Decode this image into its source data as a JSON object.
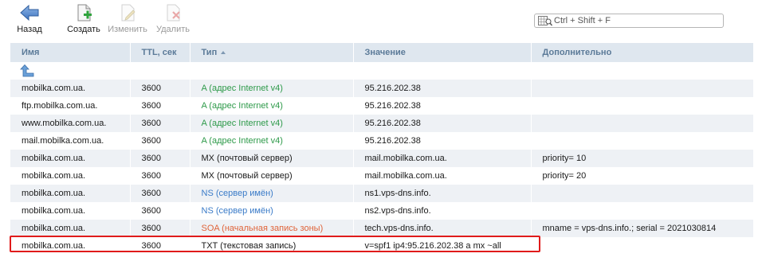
{
  "toolbar": {
    "back_label": "Назад",
    "create_label": "Создать",
    "edit_label": "Изменить",
    "delete_label": "Удалить"
  },
  "search": {
    "placeholder": "Ctrl + Shift + F"
  },
  "table": {
    "headers": {
      "name": "Имя",
      "ttl": "TTL, сек",
      "type": "Тип",
      "value": "Значение",
      "extra": "Дополнительно"
    },
    "rows": [
      {
        "name": "mobilka.com.ua.",
        "ttl": "3600",
        "type": "A (адрес Internet v4)",
        "value": "95.216.202.38",
        "extra": ""
      },
      {
        "name": "ftp.mobilka.com.ua.",
        "ttl": "3600",
        "type": "A (адрес Internet v4)",
        "value": "95.216.202.38",
        "extra": ""
      },
      {
        "name": "www.mobilka.com.ua.",
        "ttl": "3600",
        "type": "A (адрес Internet v4)",
        "value": "95.216.202.38",
        "extra": ""
      },
      {
        "name": "mail.mobilka.com.ua.",
        "ttl": "3600",
        "type": "A (адрес Internet v4)",
        "value": "95.216.202.38",
        "extra": ""
      },
      {
        "name": "mobilka.com.ua.",
        "ttl": "3600",
        "type": "MX (почтовый сервер)",
        "value": "mail.mobilka.com.ua.",
        "extra": "priority= 10"
      },
      {
        "name": "mobilka.com.ua.",
        "ttl": "3600",
        "type": "MX (почтовый сервер)",
        "value": "mail.mobilka.com.ua.",
        "extra": "priority= 20"
      },
      {
        "name": "mobilka.com.ua.",
        "ttl": "3600",
        "type": "NS (сервер имён)",
        "value": "ns1.vps-dns.info.",
        "extra": ""
      },
      {
        "name": "mobilka.com.ua.",
        "ttl": "3600",
        "type": "NS (сервер имён)",
        "value": "ns2.vps-dns.info.",
        "extra": ""
      },
      {
        "name": "mobilka.com.ua.",
        "ttl": "3600",
        "type": "SOA (начальная запись зоны)",
        "value": "tech.vps-dns.info.",
        "extra": "mname = vps-dns.info.; serial = 2021030814"
      },
      {
        "name": "mobilka.com.ua.",
        "ttl": "3600",
        "type": "TXT (текстовая запись)",
        "value": "v=spf1 ip4:95.216.202.38 a mx ~all",
        "extra": ""
      }
    ]
  },
  "colors": {
    "type_a": "#2e9a4a",
    "type_ns": "#3a7bc8",
    "type_soa": "#e0643a",
    "highlight": "#e01b1b"
  }
}
